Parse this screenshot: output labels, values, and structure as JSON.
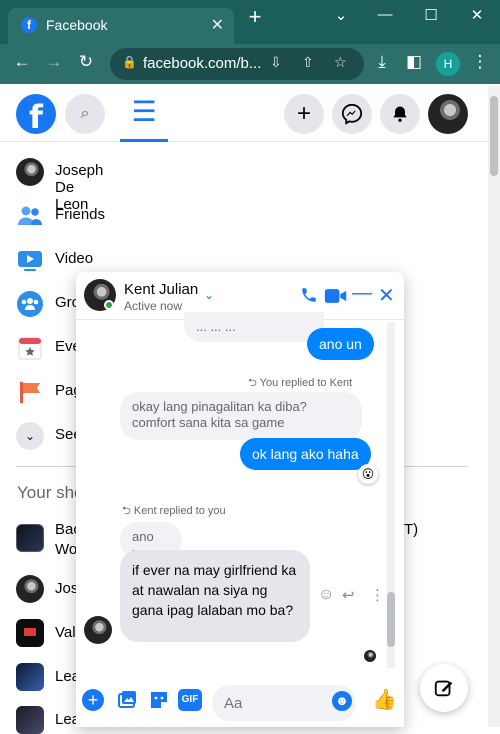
{
  "browser": {
    "tab_title": "Facebook",
    "tab_close": "✕",
    "new_tab": "+",
    "url": "facebook.com/b...",
    "profile_initial": "H",
    "window_controls": [
      "⌄",
      "—",
      "☐",
      "✕"
    ]
  },
  "fb_header": {
    "logo_letter": "f",
    "icons": [
      "search-icon",
      "menu-icon",
      "create-icon",
      "messenger-icon",
      "notifications-icon",
      "account-avatar"
    ]
  },
  "nav": {
    "items": [
      {
        "label": "Joseph De Leon",
        "icon": "profile-avatar"
      },
      {
        "label": "Friends",
        "icon": "friends-icon"
      },
      {
        "label": "Video",
        "icon": "video-icon"
      },
      {
        "label": "Gro",
        "icon": "groups-icon"
      },
      {
        "label": "Eve",
        "icon": "events-icon"
      },
      {
        "label": "Pag",
        "icon": "pages-icon"
      },
      {
        "label": "See",
        "icon": "chevron-down-icon"
      }
    ]
  },
  "shortcuts": {
    "heading": "Your sho",
    "items": [
      {
        "label": "Bac",
        "label2": "Wo",
        "suffix": "T)"
      },
      {
        "label": "Jos"
      },
      {
        "label": "Val"
      },
      {
        "label": "Lea"
      },
      {
        "label": "Lea"
      }
    ]
  },
  "chat": {
    "contact_name": "Kent Julian",
    "status": "Active now",
    "messages": {
      "top_partial": "... ... ...",
      "me_1": "ano un",
      "reply_note_1": "You replied to Kent",
      "quoted_1": "okay lang pinagalitan ka diba? comfort sana kita sa game",
      "me_2": "ok lang ako haha",
      "reaction_1": "😮",
      "reply_note_2": "Kent replied to you",
      "quoted_2": "ano un",
      "them_1": "if ever na may girlfriend ka at nawalan na siya ng gana ipag lalaban mo ba?"
    },
    "composer_placeholder": "Aa"
  },
  "colors": {
    "fb_blue": "#1877f2",
    "messenger_blue": "#0084ff",
    "chrome_tab": "#1b5e5a",
    "chrome_toolbar": "#2d6f6a"
  }
}
